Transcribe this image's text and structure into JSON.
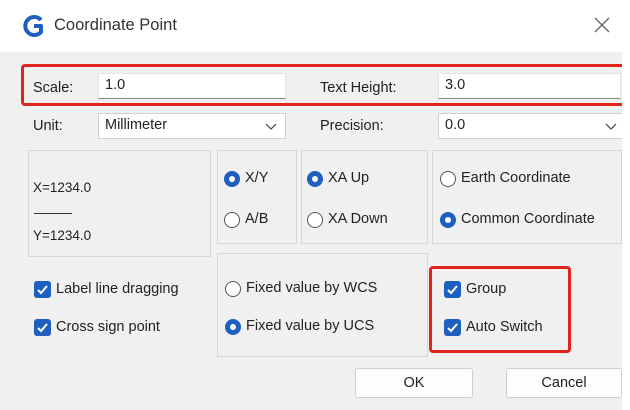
{
  "window": {
    "title": "Coordinate Point",
    "app_icon": "app-logo-icon",
    "close_icon": "close-icon"
  },
  "scale": {
    "label": "Scale:",
    "value": "1.0"
  },
  "text_height": {
    "label": "Text Height:",
    "value": "3.0"
  },
  "unit": {
    "label": "Unit:",
    "selected": "Millimeter"
  },
  "precision": {
    "label": "Precision:",
    "selected": "0.0"
  },
  "preview": {
    "x_text": "X=1234.0",
    "y_text": "Y=1234.0"
  },
  "axis_order": {
    "options": [
      "X/Y",
      "A/B"
    ],
    "selected": "X/Y"
  },
  "xa_direction": {
    "options": [
      "XA Up",
      "XA Down"
    ],
    "selected": "XA Up"
  },
  "coordinate_type": {
    "options": [
      "Earth Coordinate",
      "Common Coordinate"
    ],
    "selected": "Common Coordinate"
  },
  "options_left": {
    "label_line_dragging": "Label line dragging",
    "cross_sign_point": "Cross sign point"
  },
  "fixed_value": {
    "options": [
      "Fixed value by WCS",
      "Fixed value by UCS"
    ],
    "selected": "Fixed value by UCS"
  },
  "options_right": {
    "group": "Group",
    "auto_switch": "Auto Switch"
  },
  "checkboxes": {
    "label_line_dragging": true,
    "cross_sign_point": true,
    "group": true,
    "auto_switch": true
  },
  "buttons": {
    "ok": "OK",
    "cancel": "Cancel"
  },
  "colors": {
    "accent": "#1f5fbf",
    "highlight": "#e0241b"
  }
}
